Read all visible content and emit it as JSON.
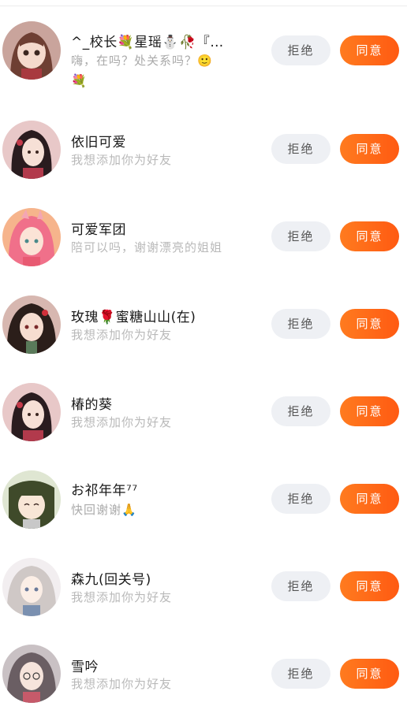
{
  "buttons": {
    "reject_label": "拒绝",
    "accept_label": "同意"
  },
  "requests": [
    {
      "name": "^_校长💐星瑶⛄🥀『…",
      "message": "嗨，在吗？处关系吗？🙂",
      "message_extra": "💐",
      "avatar_color": "#c98f8a"
    },
    {
      "name": "依旧可爱",
      "message": "我想添加你为好友",
      "avatar_color": "#b7687a"
    },
    {
      "name": "可爱军团",
      "message": "陪可以吗，谢谢漂亮的姐姐",
      "avatar_color": "#f2a07a"
    },
    {
      "name": "玫瑰🌹蜜糖山山(在)",
      "message": "我想添加你为好友",
      "avatar_color": "#8a5a55"
    },
    {
      "name": "椿的葵",
      "message": "我想添加你为好友",
      "avatar_color": "#b07080"
    },
    {
      "name": "お祁年年⁷⁷",
      "message": "快回谢谢🙏",
      "avatar_color": "#6f8a5a"
    },
    {
      "name": "森九(回关号)",
      "message": "我想添加你为好友",
      "avatar_color": "#d7d3d5"
    },
    {
      "name": "雪吟",
      "message": "我想添加你为好友",
      "avatar_color": "#9a8a92"
    }
  ]
}
